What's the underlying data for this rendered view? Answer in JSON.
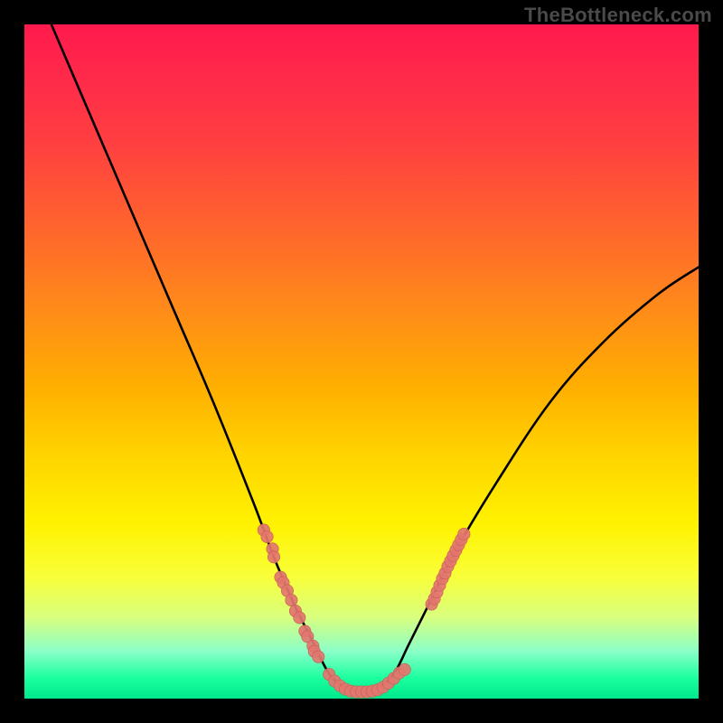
{
  "watermark": "TheBottleneck.com",
  "colors": {
    "curve_stroke": "#000000",
    "marker_fill": "#e2766f",
    "marker_stroke": "#c95b55",
    "frame_bg": "#000000"
  },
  "chart_data": {
    "type": "line",
    "title": "",
    "xlabel": "",
    "ylabel": "",
    "xlim": [
      0,
      100
    ],
    "ylim": [
      0,
      100
    ],
    "series": [
      {
        "name": "bottleneck-curve",
        "x": [
          4,
          10,
          16,
          22,
          28,
          34,
          37,
          40,
          43,
          45,
          47,
          50,
          53,
          55,
          57,
          60,
          64,
          70,
          78,
          86,
          94,
          100
        ],
        "y": [
          100,
          86,
          72,
          58,
          44,
          29,
          21,
          14,
          8,
          4,
          2,
          1,
          2,
          4,
          8,
          14,
          22,
          32,
          44,
          53,
          60,
          64
        ]
      }
    ],
    "left_marker_cluster": {
      "x_range": [
        34,
        44
      ],
      "y_range": [
        6,
        28
      ],
      "points": [
        {
          "x": 35.5,
          "y": 25.0
        },
        {
          "x": 36.0,
          "y": 24.0
        },
        {
          "x": 36.8,
          "y": 22.2
        },
        {
          "x": 37.0,
          "y": 21.0
        },
        {
          "x": 38.0,
          "y": 18.0
        },
        {
          "x": 38.4,
          "y": 17.2
        },
        {
          "x": 39.0,
          "y": 16.0
        },
        {
          "x": 39.6,
          "y": 14.6
        },
        {
          "x": 40.2,
          "y": 13.0
        },
        {
          "x": 40.8,
          "y": 12.0
        },
        {
          "x": 41.6,
          "y": 10.0
        },
        {
          "x": 42.0,
          "y": 9.2
        },
        {
          "x": 42.8,
          "y": 7.8
        },
        {
          "x": 43.0,
          "y": 7.0
        },
        {
          "x": 43.6,
          "y": 6.2
        }
      ]
    },
    "bottom_marker_cluster": {
      "x_range": [
        45,
        57
      ],
      "y_range": [
        0.8,
        4
      ],
      "points": [
        {
          "x": 45.2,
          "y": 3.6
        },
        {
          "x": 46.0,
          "y": 2.6
        },
        {
          "x": 46.8,
          "y": 1.9
        },
        {
          "x": 47.6,
          "y": 1.4
        },
        {
          "x": 48.4,
          "y": 1.1
        },
        {
          "x": 49.2,
          "y": 1.0
        },
        {
          "x": 50.0,
          "y": 1.0
        },
        {
          "x": 50.8,
          "y": 1.0
        },
        {
          "x": 51.6,
          "y": 1.1
        },
        {
          "x": 52.4,
          "y": 1.3
        },
        {
          "x": 53.2,
          "y": 1.7
        },
        {
          "x": 54.0,
          "y": 2.3
        },
        {
          "x": 54.8,
          "y": 3.0
        },
        {
          "x": 55.6,
          "y": 3.8
        },
        {
          "x": 56.4,
          "y": 4.3
        }
      ]
    },
    "right_marker_cluster": {
      "x_range": [
        60,
        66
      ],
      "y_range": [
        12,
        26
      ],
      "points": [
        {
          "x": 60.4,
          "y": 14.0
        },
        {
          "x": 60.8,
          "y": 14.8
        },
        {
          "x": 61.2,
          "y": 15.8
        },
        {
          "x": 61.6,
          "y": 16.8
        },
        {
          "x": 62.0,
          "y": 17.8
        },
        {
          "x": 62.4,
          "y": 18.6
        },
        {
          "x": 62.8,
          "y": 19.6
        },
        {
          "x": 63.2,
          "y": 20.4
        },
        {
          "x": 63.6,
          "y": 21.2
        },
        {
          "x": 64.0,
          "y": 22.0
        },
        {
          "x": 64.4,
          "y": 22.8
        },
        {
          "x": 64.8,
          "y": 23.6
        },
        {
          "x": 65.2,
          "y": 24.4
        }
      ]
    }
  }
}
